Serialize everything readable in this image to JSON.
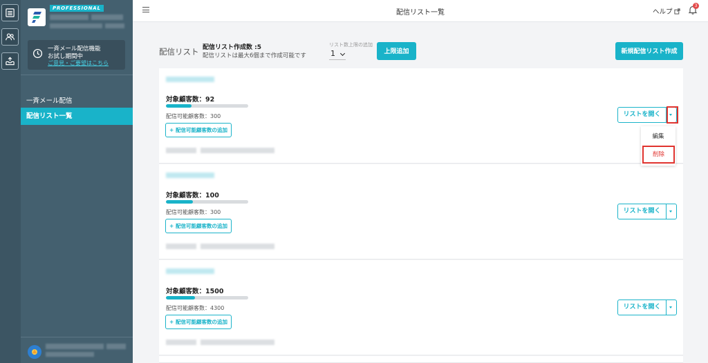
{
  "sidebar": {
    "badge": "PROFESSIONAL",
    "trial": {
      "line1": "一斉メール配信機能",
      "line2": "お試し期間中",
      "link": "ご意見・ご要望はこちら"
    },
    "nav": {
      "bulk_mail": "一斉メール配信",
      "list_overview": "配信リスト一覧"
    }
  },
  "header": {
    "title": "配信リスト一覧",
    "help": "ヘルプ",
    "notification_count": "3"
  },
  "content": {
    "page_label": "配信リスト",
    "created_count": "配信リスト作成数 :5",
    "max_note": "配信リストは最大6個まで作成可能です",
    "limit_label": "リスト数上限の追加",
    "limit_value": "1",
    "add_limit_button": "上限追加",
    "new_list_button": "新規配信リスト作成"
  },
  "cards": [
    {
      "target": "対象顧客数：92",
      "deliverable": "配信可能顧客数：300",
      "fill": 0.31
    },
    {
      "target": "対象顧客数：100",
      "deliverable": "配信可能顧客数：300",
      "fill": 0.33
    },
    {
      "target": "対象顧客数：1500",
      "deliverable": "配信可能顧客数：4300",
      "fill": 0.35
    }
  ],
  "card_labels": {
    "add_button": "+ 配信可能顧客数の追加",
    "open_button": "リストを開く"
  },
  "dropdown": {
    "edit": "編集",
    "delete": "削除"
  },
  "colors": {
    "accent": "#19b3c9",
    "sidebar": "#44606f",
    "rail": "#3c5563",
    "danger": "#e0332e"
  }
}
